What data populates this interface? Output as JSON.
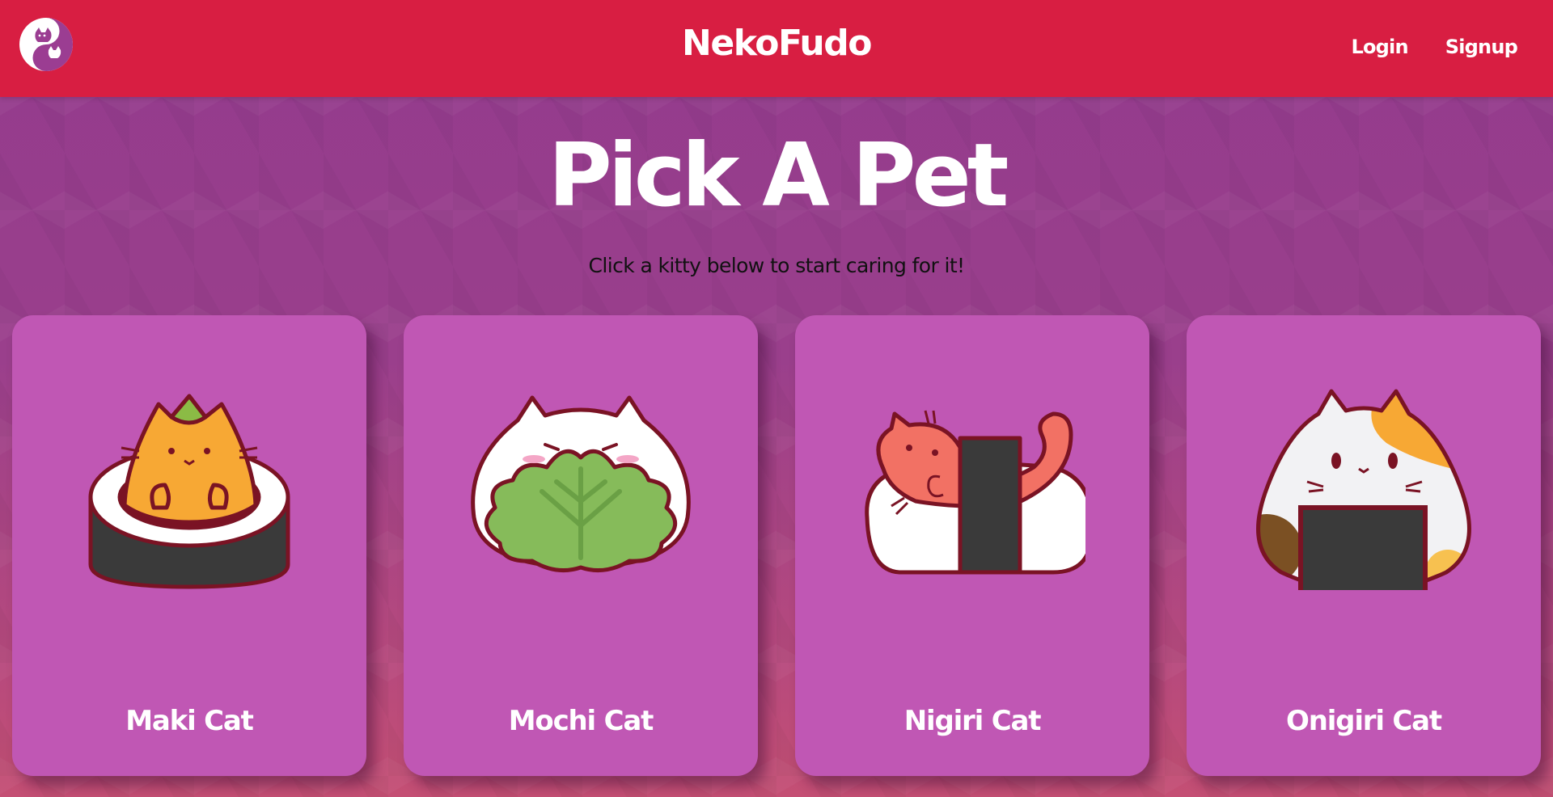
{
  "navbar": {
    "brand": "NekoFudo",
    "links": [
      {
        "label": "Login"
      },
      {
        "label": "Signup"
      }
    ],
    "color": "#d81e42"
  },
  "main": {
    "title": "Pick A Pet",
    "subtitle": "Click a kitty below to start caring for it!"
  },
  "pets": [
    {
      "name": "Maki Cat",
      "icon": "maki-cat-icon"
    },
    {
      "name": "Mochi Cat",
      "icon": "mochi-cat-icon"
    },
    {
      "name": "Nigiri Cat",
      "icon": "nigiri-cat-icon"
    },
    {
      "name": "Onigiri Cat",
      "icon": "onigiri-cat-icon"
    }
  ],
  "colors": {
    "background": "#9a3f8c",
    "card": "#c057b4",
    "outline": "#7a1324"
  }
}
